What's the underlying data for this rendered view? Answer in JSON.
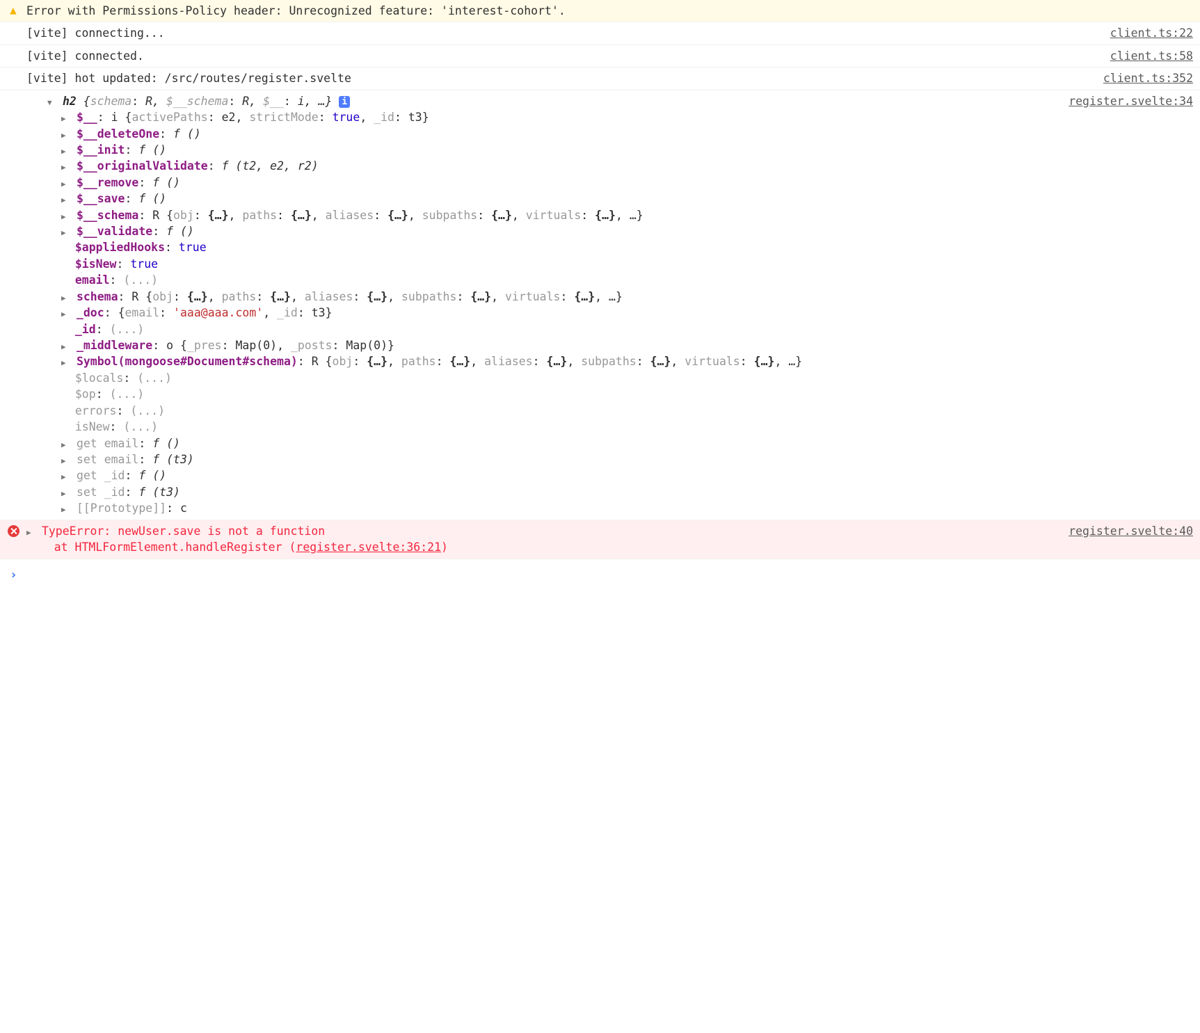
{
  "rows": {
    "warn": {
      "text": "Error with Permissions-Policy header: Unrecognized feature: 'interest-cohort'."
    },
    "c1": {
      "text": "[vite] connecting...",
      "src": "client.ts:22"
    },
    "c2": {
      "text": "[vite] connected.",
      "src": "client.ts:58"
    },
    "c3": {
      "text": "[vite] hot updated: /src/routes/register.svelte",
      "src": "client.ts:352"
    }
  },
  "obj": {
    "header": {
      "cls": "h2",
      "pairs": [
        {
          "k": "schema",
          "v": "R"
        },
        {
          "k": "$__schema",
          "v": "R"
        },
        {
          "k": "$__",
          "v": "i"
        }
      ],
      "rest": ", …",
      "src": "register.svelte:34",
      "badge": "i"
    },
    "lines": [
      {
        "tri": true,
        "seg": [
          {
            "t": "$__",
            "cls": "bold purple"
          },
          {
            "t": ": "
          },
          {
            "t": "i "
          },
          {
            "t": "{"
          },
          {
            "t": "activePaths",
            "cls": "gray"
          },
          {
            "t": ": "
          },
          {
            "t": "e2"
          },
          {
            "t": ", "
          },
          {
            "t": "strictMode",
            "cls": "gray"
          },
          {
            "t": ": "
          },
          {
            "t": "true",
            "cls": "blue"
          },
          {
            "t": ", "
          },
          {
            "t": "_id",
            "cls": "gray"
          },
          {
            "t": ": "
          },
          {
            "t": "t3"
          },
          {
            "t": "}"
          }
        ]
      },
      {
        "tri": true,
        "seg": [
          {
            "t": "$__deleteOne",
            "cls": "bold purple"
          },
          {
            "t": ": "
          },
          {
            "t": "f ()",
            "cls": "italic"
          }
        ]
      },
      {
        "tri": true,
        "seg": [
          {
            "t": "$__init",
            "cls": "bold purple"
          },
          {
            "t": ": "
          },
          {
            "t": "f ()",
            "cls": "italic"
          }
        ]
      },
      {
        "tri": true,
        "seg": [
          {
            "t": "$__originalValidate",
            "cls": "bold purple"
          },
          {
            "t": ": "
          },
          {
            "t": "f (t2, e2, r2)",
            "cls": "italic"
          }
        ]
      },
      {
        "tri": true,
        "seg": [
          {
            "t": "$__remove",
            "cls": "bold purple"
          },
          {
            "t": ": "
          },
          {
            "t": "f ()",
            "cls": "italic"
          }
        ]
      },
      {
        "tri": true,
        "seg": [
          {
            "t": "$__save",
            "cls": "bold purple"
          },
          {
            "t": ": "
          },
          {
            "t": "f ()",
            "cls": "italic"
          }
        ]
      },
      {
        "tri": true,
        "seg": [
          {
            "t": "$__schema",
            "cls": "bold purple"
          },
          {
            "t": ": "
          },
          {
            "t": "R "
          },
          {
            "t": "{"
          },
          {
            "t": "obj",
            "cls": "gray"
          },
          {
            "t": ": "
          },
          {
            "t": "{…}",
            "cls": "bold"
          },
          {
            "t": ", "
          },
          {
            "t": "paths",
            "cls": "gray"
          },
          {
            "t": ": "
          },
          {
            "t": "{…}",
            "cls": "bold"
          },
          {
            "t": ", "
          },
          {
            "t": "aliases",
            "cls": "gray"
          },
          {
            "t": ": "
          },
          {
            "t": "{…}",
            "cls": "bold"
          },
          {
            "t": ", "
          },
          {
            "t": "subpaths",
            "cls": "gray"
          },
          {
            "t": ": "
          },
          {
            "t": "{…}",
            "cls": "bold"
          },
          {
            "t": ", "
          },
          {
            "t": "virtuals",
            "cls": "gray"
          },
          {
            "t": ": "
          },
          {
            "t": "{…}",
            "cls": "bold"
          },
          {
            "t": ", …}"
          }
        ]
      },
      {
        "tri": true,
        "seg": [
          {
            "t": "$__validate",
            "cls": "bold purple"
          },
          {
            "t": ": "
          },
          {
            "t": "f ()",
            "cls": "italic"
          }
        ]
      },
      {
        "tri": false,
        "seg": [
          {
            "t": "$appliedHooks",
            "cls": "bold purple"
          },
          {
            "t": ": "
          },
          {
            "t": "true",
            "cls": "blue"
          }
        ]
      },
      {
        "tri": false,
        "seg": [
          {
            "t": "$isNew",
            "cls": "bold purple"
          },
          {
            "t": ": "
          },
          {
            "t": "true",
            "cls": "blue"
          }
        ]
      },
      {
        "tri": false,
        "seg": [
          {
            "t": "email",
            "cls": "bold purple"
          },
          {
            "t": ": "
          },
          {
            "t": "(...)",
            "cls": "gray"
          }
        ]
      },
      {
        "tri": true,
        "seg": [
          {
            "t": "schema",
            "cls": "bold purple"
          },
          {
            "t": ": "
          },
          {
            "t": "R "
          },
          {
            "t": "{"
          },
          {
            "t": "obj",
            "cls": "gray"
          },
          {
            "t": ": "
          },
          {
            "t": "{…}",
            "cls": "bold"
          },
          {
            "t": ", "
          },
          {
            "t": "paths",
            "cls": "gray"
          },
          {
            "t": ": "
          },
          {
            "t": "{…}",
            "cls": "bold"
          },
          {
            "t": ", "
          },
          {
            "t": "aliases",
            "cls": "gray"
          },
          {
            "t": ": "
          },
          {
            "t": "{…}",
            "cls": "bold"
          },
          {
            "t": ", "
          },
          {
            "t": "subpaths",
            "cls": "gray"
          },
          {
            "t": ": "
          },
          {
            "t": "{…}",
            "cls": "bold"
          },
          {
            "t": ", "
          },
          {
            "t": "virtuals",
            "cls": "gray"
          },
          {
            "t": ": "
          },
          {
            "t": "{…}",
            "cls": "bold"
          },
          {
            "t": ", …}"
          }
        ]
      },
      {
        "tri": true,
        "seg": [
          {
            "t": "_doc",
            "cls": "bold purple"
          },
          {
            "t": ": "
          },
          {
            "t": "{"
          },
          {
            "t": "email",
            "cls": "gray"
          },
          {
            "t": ": "
          },
          {
            "t": "'aaa@aaa.com'",
            "cls": "redstr"
          },
          {
            "t": ", "
          },
          {
            "t": "_id",
            "cls": "gray"
          },
          {
            "t": ": "
          },
          {
            "t": "t3"
          },
          {
            "t": "}"
          }
        ]
      },
      {
        "tri": false,
        "seg": [
          {
            "t": "_id",
            "cls": "bold purple"
          },
          {
            "t": ": "
          },
          {
            "t": "(...)",
            "cls": "gray"
          }
        ]
      },
      {
        "tri": true,
        "seg": [
          {
            "t": "_middleware",
            "cls": "bold purple"
          },
          {
            "t": ": "
          },
          {
            "t": "o "
          },
          {
            "t": "{"
          },
          {
            "t": "_pres",
            "cls": "gray"
          },
          {
            "t": ": "
          },
          {
            "t": "Map(0)"
          },
          {
            "t": ", "
          },
          {
            "t": "_posts",
            "cls": "gray"
          },
          {
            "t": ": "
          },
          {
            "t": "Map(0)"
          },
          {
            "t": "}"
          }
        ]
      },
      {
        "tri": true,
        "seg": [
          {
            "t": "Symbol(mongoose#Document#schema)",
            "cls": "bold purple"
          },
          {
            "t": ": "
          },
          {
            "t": "R "
          },
          {
            "t": "{"
          },
          {
            "t": "obj",
            "cls": "gray"
          },
          {
            "t": ": "
          },
          {
            "t": "{…}",
            "cls": "bold"
          },
          {
            "t": ", "
          },
          {
            "t": "paths",
            "cls": "gray"
          },
          {
            "t": ": "
          },
          {
            "t": "{…}",
            "cls": "bold"
          },
          {
            "t": ", "
          },
          {
            "t": "aliases",
            "cls": "gray"
          },
          {
            "t": ": "
          },
          {
            "t": "{…}",
            "cls": "bold"
          },
          {
            "t": ", "
          },
          {
            "t": "subpaths",
            "cls": "gray"
          },
          {
            "t": ": "
          },
          {
            "t": "{…}",
            "cls": "bold"
          },
          {
            "t": ", "
          },
          {
            "t": "virtuals",
            "cls": "gray"
          },
          {
            "t": ": "
          },
          {
            "t": "{…}",
            "cls": "bold"
          },
          {
            "t": ", …}"
          }
        ]
      },
      {
        "tri": false,
        "seg": [
          {
            "t": "$locals",
            "cls": "gray"
          },
          {
            "t": ": "
          },
          {
            "t": "(...)",
            "cls": "gray"
          }
        ]
      },
      {
        "tri": false,
        "seg": [
          {
            "t": "$op",
            "cls": "gray"
          },
          {
            "t": ": "
          },
          {
            "t": "(...)",
            "cls": "gray"
          }
        ]
      },
      {
        "tri": false,
        "seg": [
          {
            "t": "errors",
            "cls": "gray"
          },
          {
            "t": ": "
          },
          {
            "t": "(...)",
            "cls": "gray"
          }
        ]
      },
      {
        "tri": false,
        "seg": [
          {
            "t": "isNew",
            "cls": "gray"
          },
          {
            "t": ": "
          },
          {
            "t": "(...)",
            "cls": "gray"
          }
        ]
      },
      {
        "tri": true,
        "seg": [
          {
            "t": "get ",
            "cls": "gray"
          },
          {
            "t": "email",
            "cls": "gray"
          },
          {
            "t": ": "
          },
          {
            "t": "f ()",
            "cls": "italic"
          }
        ]
      },
      {
        "tri": true,
        "seg": [
          {
            "t": "set ",
            "cls": "gray"
          },
          {
            "t": "email",
            "cls": "gray"
          },
          {
            "t": ": "
          },
          {
            "t": "f (t3)",
            "cls": "italic"
          }
        ]
      },
      {
        "tri": true,
        "seg": [
          {
            "t": "get ",
            "cls": "gray"
          },
          {
            "t": "_id",
            "cls": "gray"
          },
          {
            "t": ": "
          },
          {
            "t": "f ()",
            "cls": "italic"
          }
        ]
      },
      {
        "tri": true,
        "seg": [
          {
            "t": "set ",
            "cls": "gray"
          },
          {
            "t": "_id",
            "cls": "gray"
          },
          {
            "t": ": "
          },
          {
            "t": "f (t3)",
            "cls": "italic"
          }
        ]
      },
      {
        "tri": true,
        "seg": [
          {
            "t": "[[Prototype]]",
            "cls": "gray"
          },
          {
            "t": ": "
          },
          {
            "t": "c"
          }
        ]
      }
    ]
  },
  "error": {
    "msg": "TypeError: newUser.save is not a function",
    "stack_pre": "    at HTMLFormElement.handleRegister (",
    "stack_link": "register.svelte:36:21",
    "stack_post": ")",
    "src": "register.svelte:40"
  },
  "prompt": "›"
}
